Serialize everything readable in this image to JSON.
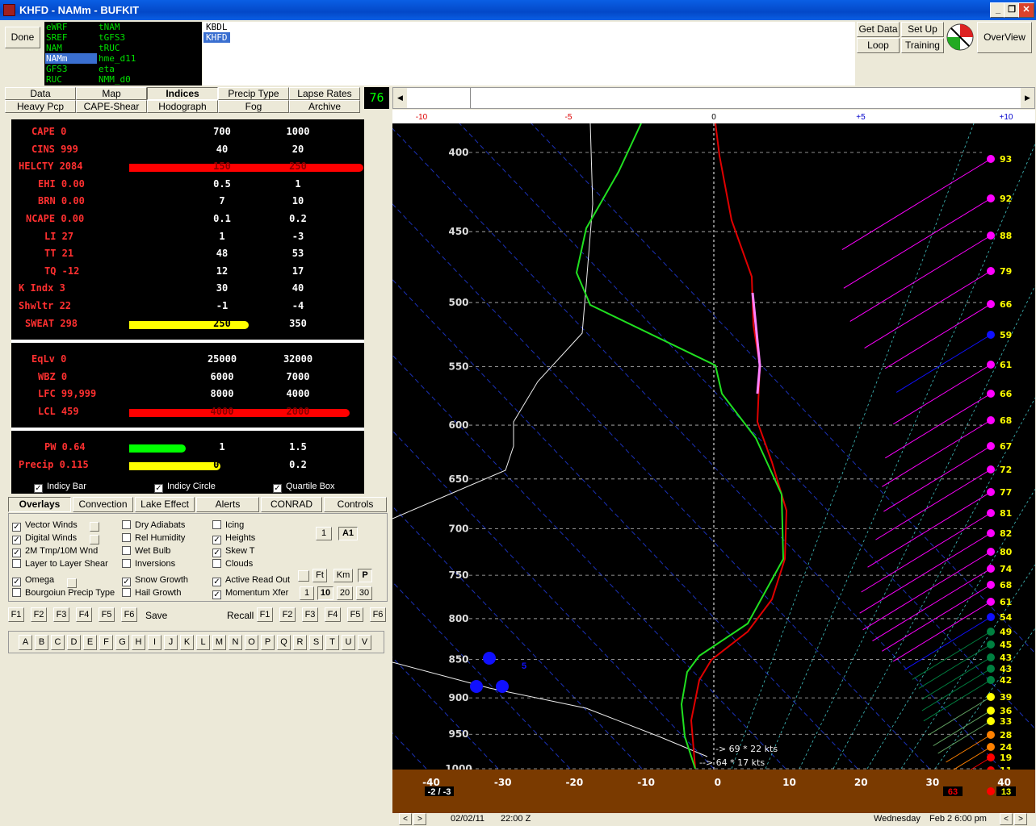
{
  "window": {
    "title": "KHFD - NAMm - BUFKIT"
  },
  "toolbar": {
    "done": "Done",
    "get_data": "Get Data",
    "set_up": "Set Up",
    "loop": "Loop",
    "training": "Training",
    "overview": "OverView"
  },
  "models": [
    "eWRF",
    "tNAM",
    "SREF",
    "tGFS3",
    "NAM",
    "tRUC",
    "NAMm",
    "hme_d11",
    "GFS3",
    "eta",
    "RUC",
    "NMM_d0"
  ],
  "models_selected": "NAMm",
  "stations": [
    "KBDL",
    "KHFD"
  ],
  "station_selected": "KHFD",
  "tabs_row1": [
    "Data",
    "Map",
    "Indices",
    "Precip Type",
    "Lapse Rates"
  ],
  "tabs_row2": [
    "Heavy Pcp",
    "CAPE-Shear",
    "Hodograph",
    "Fog",
    "Archive"
  ],
  "active_tab": "Indices",
  "frame_counter": "76",
  "indices": [
    {
      "label": "CAPE",
      "value": "0",
      "q1": "700",
      "q2": "1000"
    },
    {
      "label": "CINS",
      "value": "999",
      "q1": "40",
      "q2": "20"
    },
    {
      "label": "HELCTY",
      "value": "2084",
      "q1": "150",
      "q2": "250",
      "bar": "red",
      "bar_fraction": 1.0
    },
    {
      "label": "EHI",
      "value": "0.00",
      "q1": "0.5",
      "q2": "1"
    },
    {
      "label": "BRN",
      "value": "0.00",
      "q1": "7",
      "q2": "10"
    },
    {
      "label": "NCAPE",
      "value": "0.00",
      "q1": "0.1",
      "q2": "0.2"
    },
    {
      "label": "LI",
      "value": "27",
      "q1": "1",
      "q2": "-3"
    },
    {
      "label": "TT",
      "value": "21",
      "q1": "48",
      "q2": "53"
    },
    {
      "label": "TQ",
      "value": "-12",
      "q1": "12",
      "q2": "17"
    },
    {
      "label": "K Indx",
      "value": "3",
      "q1": "30",
      "q2": "40"
    },
    {
      "label": "Shwltr",
      "value": "22",
      "q1": "-1",
      "q2": "-4"
    },
    {
      "label": "SWEAT",
      "value": "298",
      "q1": "250",
      "q2": "350",
      "bar": "yellow",
      "bar_fraction": 0.51
    }
  ],
  "indices2": [
    {
      "label": "EqLv",
      "value": "0",
      "q1": "25000",
      "q2": "32000"
    },
    {
      "label": "WBZ",
      "value": "0",
      "q1": "6000",
      "q2": "7000"
    },
    {
      "label": "LFC",
      "value": "99,999",
      "q1": "8000",
      "q2": "4000"
    },
    {
      "label": "LCL",
      "value": "459",
      "q1": "4000",
      "q2": "2000",
      "bar": "red",
      "bar_fraction": 0.94
    }
  ],
  "indices3": [
    {
      "label": "PW",
      "value": "0.64",
      "q1": "1",
      "q2": "1.5",
      "bar": "green",
      "bar_fraction": 0.24
    },
    {
      "label": "Precip",
      "value": "0.115",
      "q1": "0.1",
      "q2": "0.2",
      "bar": "yellow",
      "bar_fraction": 0.39
    }
  ],
  "indicy_checks": [
    "Indicy Bar",
    "Indicy Circle",
    "Quartile Box"
  ],
  "overlay_tabs": [
    "Overlays",
    "Convection",
    "Lake Effect",
    "Alerts",
    "CONRAD",
    "Controls"
  ],
  "overlay_col1": [
    {
      "t": "Vector Winds",
      "c": true
    },
    {
      "t": "Digital Winds",
      "c": true
    },
    {
      "t": "2M Tmp/10M Wnd",
      "c": true
    },
    {
      "t": "Layer to Layer Shear",
      "c": false
    },
    {
      "t": "Omega",
      "c": true
    },
    {
      "t": "Bourgoiun Precip Type",
      "c": false
    }
  ],
  "overlay_col2": [
    {
      "t": "Dry Adiabats",
      "c": false
    },
    {
      "t": "Rel Humidity",
      "c": false
    },
    {
      "t": "Wet Bulb",
      "c": false
    },
    {
      "t": "Inversions",
      "c": false
    },
    {
      "t": "Snow Growth",
      "c": true
    },
    {
      "t": "Hail Growth",
      "c": false
    }
  ],
  "overlay_col3": [
    {
      "t": "Icing",
      "c": false
    },
    {
      "t": "Heights",
      "c": true
    },
    {
      "t": "Skew T",
      "c": true
    },
    {
      "t": "Clouds",
      "c": false
    },
    {
      "t": "Active Read Out",
      "c": true
    },
    {
      "t": "Momentum Xfer",
      "c": true
    }
  ],
  "small_btns": {
    "one": "1",
    "a1": "A1",
    "ft": "Ft",
    "km": "Km",
    "p": "P",
    "b1": "1",
    "b10": "10",
    "b20": "20",
    "b30": "30"
  },
  "fkeys": [
    "F1",
    "F2",
    "F3",
    "F4",
    "F5",
    "F6"
  ],
  "save": "Save",
  "recall": "Recall",
  "letters": [
    "A",
    "B",
    "C",
    "D",
    "E",
    "F",
    "G",
    "H",
    "I",
    "J",
    "K",
    "L",
    "M",
    "N",
    "O",
    "P",
    "Q",
    "R",
    "S",
    "T",
    "U",
    "V"
  ],
  "skewt": {
    "top_ticks": [
      "-10",
      "-5",
      "0",
      "+5",
      "+10"
    ],
    "pressure_labels": [
      "400",
      "450",
      "500",
      "550",
      "600",
      "650",
      "700",
      "750",
      "800",
      "850",
      "900",
      "950",
      "1000"
    ],
    "temp_labels": [
      "-40",
      "-30",
      "-20",
      "-10",
      "0",
      "10",
      "20",
      "30",
      "40"
    ],
    "wind_speeds": [
      "93",
      "92",
      "88",
      "79",
      "66",
      "59",
      "61",
      "66",
      "68",
      "67",
      "72",
      "77",
      "81",
      "82",
      "80",
      "74",
      "68",
      "61",
      "54",
      "49",
      "45",
      "43",
      "43",
      "42",
      "39",
      "36",
      "33",
      "28",
      "24",
      "19",
      "11"
    ],
    "readout1": "69 * 22 kts",
    "readout2": "64 * 17 kts",
    "surface_left": "-2 / -3",
    "surface_right1": "63",
    "surface_right2": "13",
    "label5": "5"
  },
  "status": {
    "date": "02/02/11",
    "time": "22:00 Z",
    "day": "Wednesday",
    "local": "Feb 2  6:00 pm"
  }
}
